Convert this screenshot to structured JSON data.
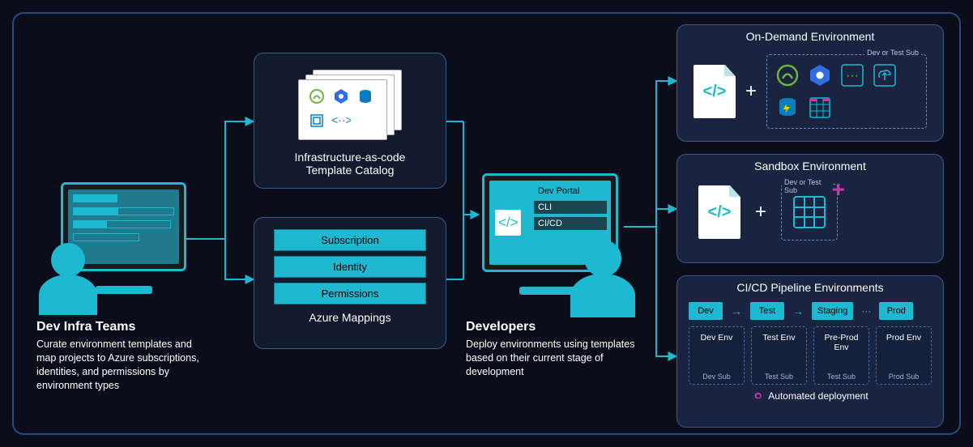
{
  "dev_infra": {
    "heading": "Dev Infra Teams",
    "desc": "Curate environment templates and map projects to Azure subscriptions, identities, and permissions by environment types"
  },
  "iac": {
    "title": "Infrastructure-as-code\nTemplate Catalog"
  },
  "azure_mappings": {
    "title": "Azure Mappings",
    "items": [
      "Subscription",
      "Identity",
      "Permissions"
    ]
  },
  "developers": {
    "heading": "Developers",
    "desc": "Deploy environments using templates based on their current stage of development",
    "tools": [
      "Dev Portal",
      "CLI",
      "CI/CD"
    ]
  },
  "on_demand": {
    "title": "On-Demand Environment",
    "group_label": "Dev or Test Sub"
  },
  "sandbox": {
    "title": "Sandbox Environment",
    "group_label": "Dev or Test Sub"
  },
  "cicd": {
    "title": "CI/CD Pipeline Environments",
    "stages": [
      "Dev",
      "Test",
      "Staging",
      "Prod"
    ],
    "envs": [
      {
        "name": "Dev Env",
        "sub": "Dev Sub"
      },
      {
        "name": "Test Env",
        "sub": "Test Sub"
      },
      {
        "name": "Pre-Prod Env",
        "sub": "Test Sub"
      },
      {
        "name": "Prod Env",
        "sub": "Prod Sub"
      }
    ],
    "automated": "Automated deployment"
  },
  "plus": "+",
  "ellipsis": "···"
}
